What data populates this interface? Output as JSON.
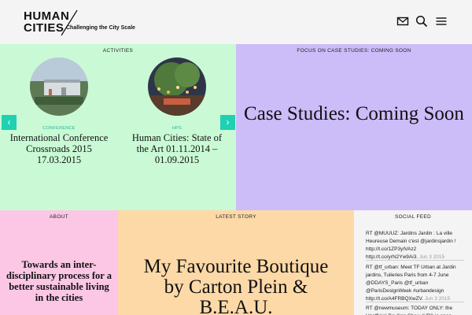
{
  "header": {
    "logo_line1": "HUMAN",
    "logo_line2": "CITIES",
    "tagline": "Challenging the City Scale"
  },
  "icons": {
    "mail": "mail-icon",
    "search": "search-icon",
    "menu": "hamburger-menu-icon"
  },
  "activities": {
    "label": "ACTIVITIES",
    "items": [
      {
        "category": "CONFERENCE",
        "title": "International Conference Crossroads 2015 17.03.2015"
      },
      {
        "category": "HPS",
        "title": "Human Cities: State of the Art 01.11.2014 – 01.09.2015"
      }
    ]
  },
  "focus": {
    "label": "FOCUS ON CASE STUDIES: COMING SOON",
    "title": "Case Studies: Coming Soon"
  },
  "about": {
    "label": "ABOUT",
    "text": "Towards an inter-disciplinary process for a better sustainable living in the cities"
  },
  "latest": {
    "label": "LATEST STORY",
    "title": "My Favourite Boutique by Carton Plein & B.E.A.U."
  },
  "social": {
    "label": "SOCIAL FEED",
    "items": [
      {
        "text": "RT @MUUUZ: Jardins Jardin : La ville Heureuse Demain c'est @jardinsjardin ! http://t.co/1ZP3yIVAz2 http://t.co/yrN2Yw9Ai3.",
        "date": "Jun 3 2015"
      },
      {
        "text": "RT @tf_urban: Meet TF Urban at Jardin jardins, Tuileries Paris from 4-7 June @DDAYS_Paris @tf_urban @ParisDesignWeek #urbandesign http://t.co/A4FRBQXwZV.",
        "date": "Jun 3 2015"
      },
      {
        "text": "RT @newmuseum: TODAY ONLY: the Unofficial Pavilion Show (UP!) is open",
        "date": ""
      }
    ]
  },
  "colors": {
    "activities_bg": "#c9fad5",
    "focus_bg": "#ccbcf8",
    "about_bg": "#fbc7e5",
    "latest_bg": "#fcd9a7",
    "accent": "#1fd0b2"
  }
}
